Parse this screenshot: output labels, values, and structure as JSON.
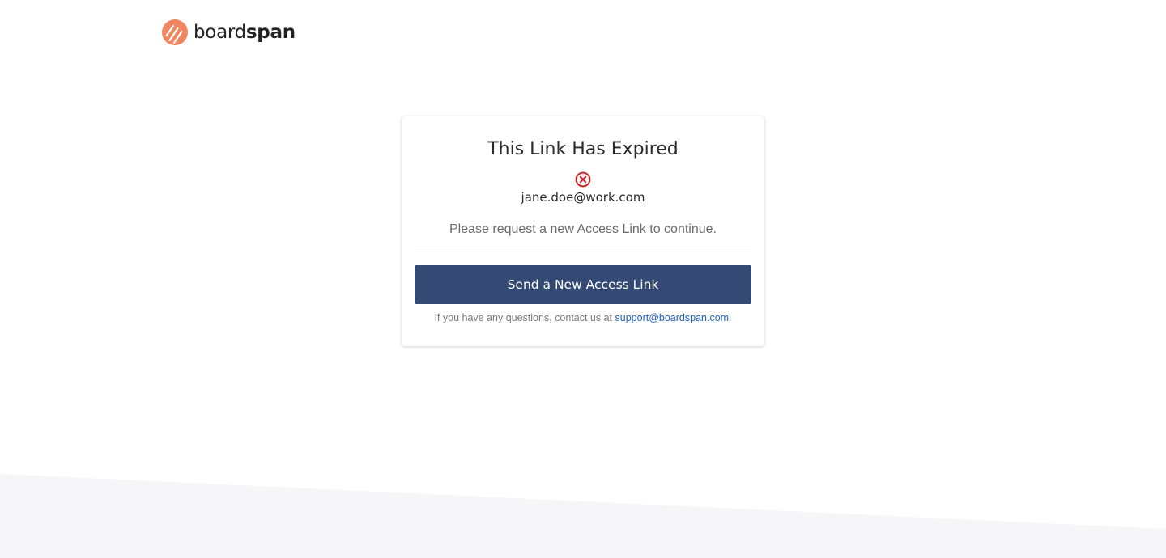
{
  "brand": {
    "name_light": "board",
    "name_bold": "span",
    "logo_color": "#f0865f",
    "text_color": "#222222"
  },
  "card": {
    "title": "This Link Has Expired",
    "status_icon": "error-circle-x-icon",
    "status_color": "#cc1f1f",
    "email": "jane.doe@work.com",
    "message": "Please request a new Access Link to continue.",
    "button_label": "Send a New Access Link",
    "button_color": "#344a75",
    "footer_prefix": "If you have any questions, contact us at ",
    "support_email": "support@boardspan.com",
    "footer_suffix": ".",
    "link_color": "#1f63c0"
  },
  "background": {
    "base_color": "#ffffff",
    "slant_color": "#f6f6f8"
  }
}
